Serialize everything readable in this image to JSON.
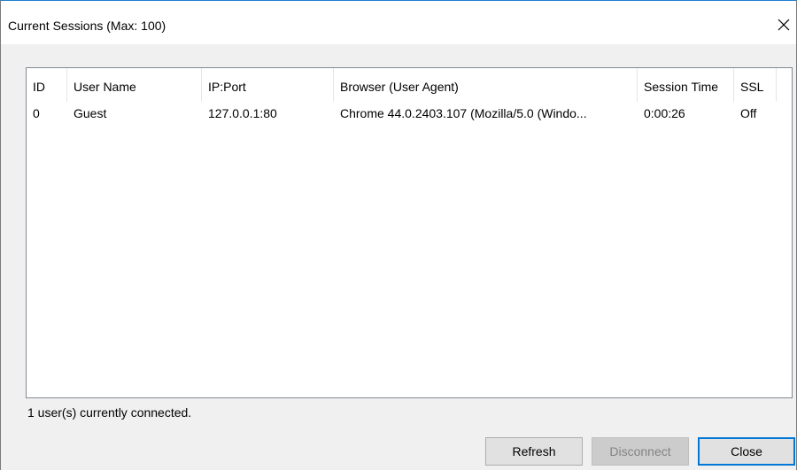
{
  "window": {
    "title": "Current Sessions (Max: 100)",
    "close_icon": "close-icon"
  },
  "table": {
    "columns": [
      "ID",
      "User Name",
      "IP:Port",
      "Browser (User Agent)",
      "Session Time",
      "SSL"
    ],
    "rows": [
      [
        "0",
        "Guest",
        "127.0.0.1:80",
        "Chrome 44.0.2403.107 (Mozilla/5.0 (Windo...",
        "0:00:26",
        "Off"
      ]
    ]
  },
  "status_text": "1 user(s) currently connected.",
  "buttons": {
    "refresh": "Refresh",
    "disconnect": "Disconnect",
    "close": "Close"
  },
  "colors": {
    "accent": "#0078d7",
    "title_border": "#1c7fd0"
  }
}
